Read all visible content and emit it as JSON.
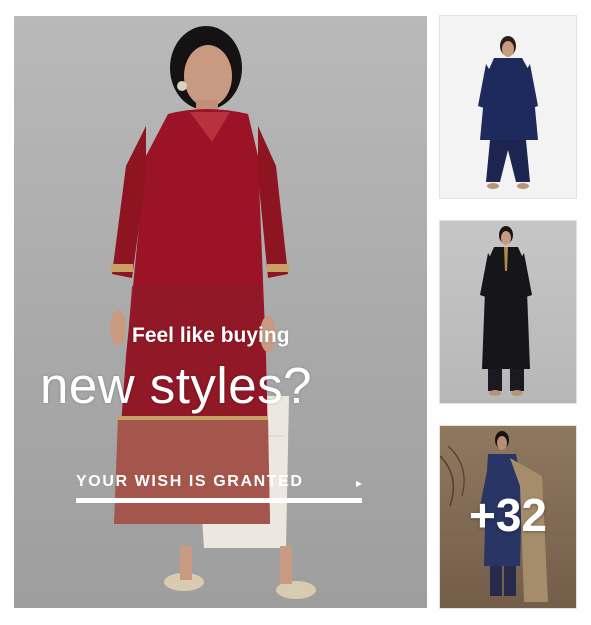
{
  "hero": {
    "headline_small": "Feel like buying",
    "headline_large": "new styles?",
    "cta_label": "YOUR WISH IS GRANTED",
    "cta_arrow": "▸"
  },
  "thumbnails": [
    {
      "description": "navy kurta with palazzo"
    },
    {
      "description": "black kurta with pants"
    },
    {
      "description": "printed kurta with dupatta"
    }
  ],
  "more": {
    "count_label": "+32"
  },
  "colors": {
    "kurta_red": "#9b1327",
    "navy": "#1f2a5c",
    "black_kurta": "#16161a",
    "tan_backdrop": "#8a7258",
    "overlay_text": "#ffffff"
  }
}
